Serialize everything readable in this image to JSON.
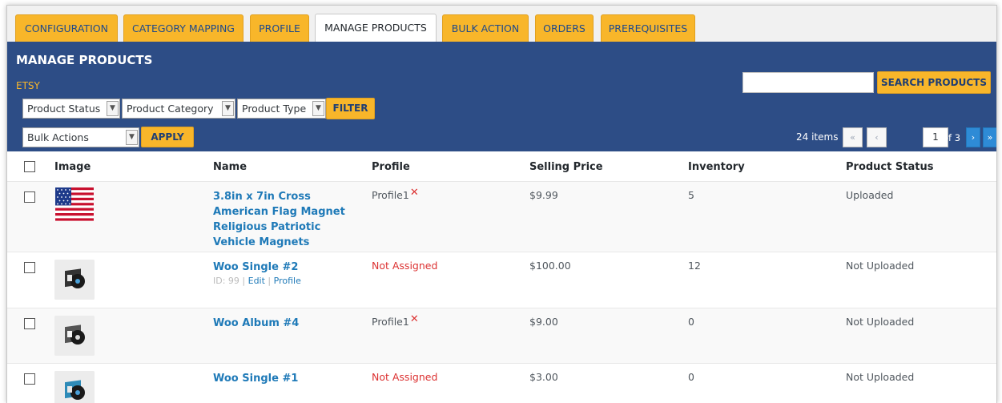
{
  "tabs": [
    {
      "label": "CONFIGURATION",
      "active": false
    },
    {
      "label": "CATEGORY MAPPING",
      "active": false
    },
    {
      "label": "PROFILE",
      "active": false
    },
    {
      "label": "MANAGE PRODUCTS",
      "active": true
    },
    {
      "label": "BULK ACTION",
      "active": false
    },
    {
      "label": "ORDERS",
      "active": false
    },
    {
      "label": "PREREQUISITES",
      "active": false
    }
  ],
  "panel": {
    "title": "MANAGE PRODUCTS",
    "marketplace": "ETSY",
    "search": {
      "value": "",
      "button": "SEARCH PRODUCTS"
    },
    "filters": {
      "product_status": "Product Status",
      "product_category": "Product Category",
      "product_type": "Product Type",
      "button": "FILTER"
    },
    "bulk": {
      "selected": "Bulk Actions",
      "button": "APPLY"
    },
    "pagination": {
      "count": "24 items",
      "first": "«",
      "prev": "‹",
      "current": "1",
      "of": "of 3",
      "next": "›",
      "last": "»"
    }
  },
  "table": {
    "headers": {
      "image": "Image",
      "name": "Name",
      "profile": "Profile",
      "price": "Selling Price",
      "inventory": "Inventory",
      "status": "Product Status"
    },
    "rows": [
      {
        "name": "3.8in x 7in Cross American Flag Magnet Religious Patriotic Vehicle Magnets",
        "profile": "Profile1",
        "price": "$9.99",
        "inventory": "5",
        "status": "Uploaded",
        "image_icon": "us-flag-icon"
      },
      {
        "name": "Woo Single #2",
        "row_id": "ID: 99",
        "edit": "Edit",
        "profile_link": "Profile",
        "profile": "Not Assigned",
        "price": "$100.00",
        "inventory": "12",
        "status": "Not Uploaded",
        "image_icon": "vinyl-record-icon"
      },
      {
        "name": "Woo Album #4",
        "profile": "Profile1",
        "price": "$9.00",
        "inventory": "0",
        "status": "Not Uploaded",
        "image_icon": "vinyl-record-icon"
      },
      {
        "name": "Woo Single #1",
        "profile": "Not Assigned",
        "price": "$3.00",
        "inventory": "0",
        "status": "Not Uploaded",
        "image_icon": "vinyl-record-icon"
      }
    ],
    "remove_mark": "✕"
  },
  "colors": {
    "panel_blue": "#2d4d86",
    "tab_yellow": "#f8b62a",
    "link_blue": "#1f7ab8",
    "not_assigned_red": "#dc3232"
  }
}
